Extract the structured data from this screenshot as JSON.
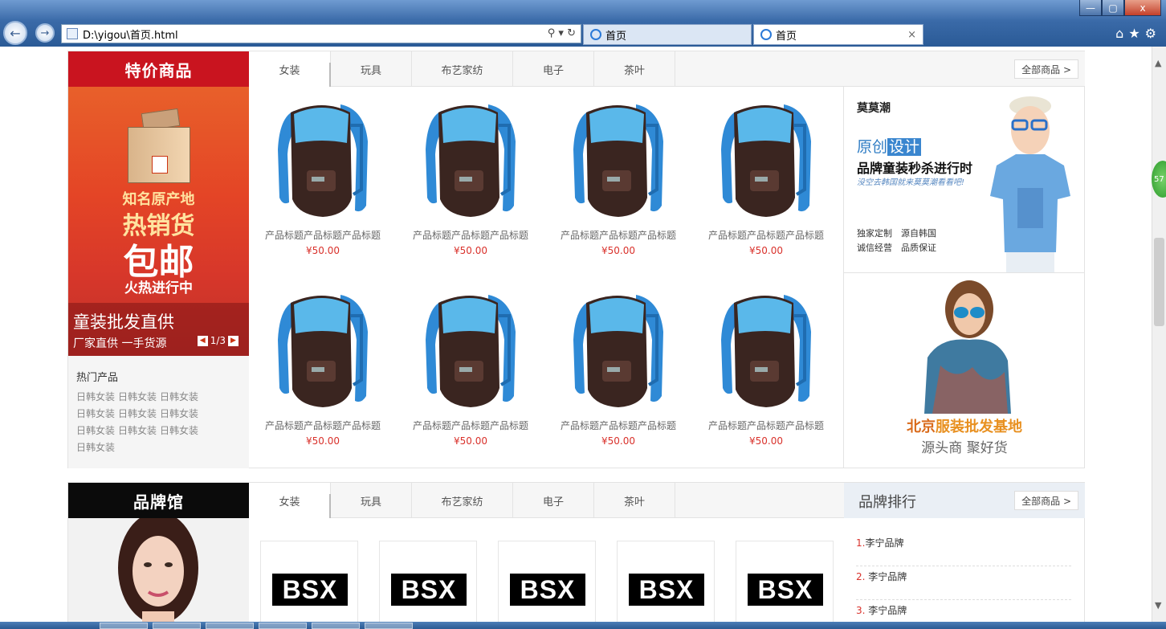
{
  "browser": {
    "address": "D:\\yigou\\首页.html",
    "tabs": [
      {
        "label": "首页",
        "active": false
      },
      {
        "label": "首页",
        "active": true
      }
    ],
    "close_glyph": "×",
    "window_buttons": {
      "minimize": "—",
      "maximize": "▢",
      "close": "x"
    }
  },
  "section1": {
    "heading": "特价商品",
    "promo": {
      "line1": "知名原产地",
      "line2": "热销货",
      "line3": "包邮",
      "line4": "火热进行中",
      "bar_title": "童装批发直供",
      "bar_sub": "厂家直供 一手货源",
      "pager": "1/3"
    },
    "hot": {
      "title": "热门产品",
      "items": [
        "日韩女装",
        "日韩女装",
        "日韩女装",
        "日韩女装",
        "日韩女装",
        "日韩女装",
        "日韩女装",
        "日韩女装",
        "日韩女装",
        "日韩女装"
      ]
    },
    "tabs": [
      "女装",
      "玩具",
      "布艺家纺",
      "电子",
      "茶叶"
    ],
    "all_button": "全部商品 >",
    "products": [
      {
        "title": "产品标题产品标题产品标题",
        "price": "¥50.00"
      },
      {
        "title": "产品标题产品标题产品标题",
        "price": "¥50.00"
      },
      {
        "title": "产品标题产品标题产品标题",
        "price": "¥50.00"
      },
      {
        "title": "产品标题产品标题产品标题",
        "price": "¥50.00"
      },
      {
        "title": "产品标题产品标题产品标题",
        "price": "¥50.00"
      },
      {
        "title": "产品标题产品标题产品标题",
        "price": "¥50.00"
      },
      {
        "title": "产品标题产品标题产品标题",
        "price": "¥50.00"
      },
      {
        "title": "产品标题产品标题产品标题",
        "price": "¥50.00"
      }
    ],
    "ad1": {
      "brand": "莫莫潮",
      "yuan_a": "原创",
      "yuan_b": "设计",
      "slogan": "品牌童装秒杀进行时",
      "sub": "没空去韩国就来莫莫潮看看吧!",
      "feature1": "独家定制　源自韩国",
      "feature2": "诚信经营　品质保证"
    },
    "ad2": {
      "t1a": "北京",
      "t1b": "服装批发基地",
      "t2": "源头商 聚好货"
    }
  },
  "section2": {
    "heading": "品牌馆",
    "tabs": [
      "女装",
      "玩具",
      "布艺家纺",
      "电子",
      "茶叶"
    ],
    "rank_title": "品牌排行",
    "all_button": "全部商品 >",
    "logos": [
      "BSX",
      "BSX",
      "BSX",
      "BSX",
      "BSX"
    ],
    "ranks": [
      {
        "n": "1.",
        "name": "李宁品牌"
      },
      {
        "n": "2. ",
        "name": "李宁品牌"
      },
      {
        "n": "3. ",
        "name": "李宁品牌"
      }
    ]
  },
  "badge": "57",
  "colors": {
    "red": "#c9141f",
    "price": "#d9312b",
    "blue": "#3a86cf",
    "orange": "#d96a1a"
  }
}
